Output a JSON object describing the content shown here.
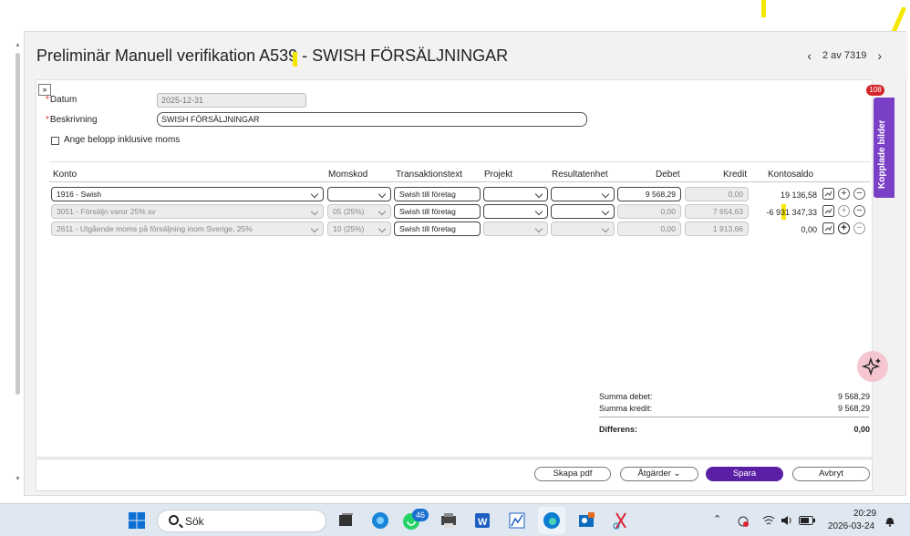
{
  "header": {
    "title": "Preliminär Manuell verifikation A539  - SWISH FÖRSÄLJNINGAR",
    "page_counter": "2 av 7319"
  },
  "form": {
    "datum_label": "Datum",
    "datum_value": "2025-12-31",
    "beskrivning_label": "Beskrivning",
    "beskrivning_value": "SWISH FÖRSÄLJNINGAR",
    "moms_checkbox_label": "Ange belopp inklusive moms"
  },
  "table": {
    "headers": {
      "konto": "Konto",
      "momskod": "Momskod",
      "transaktionstext": "Transaktionstext",
      "projekt": "Projekt",
      "resultatenhet": "Resultatenhet",
      "debet": "Debet",
      "kredit": "Kredit",
      "kontosaldo": "Kontosaldo"
    },
    "rows": [
      {
        "konto": "1916 - Swish",
        "momskod": "",
        "text": "Swish till företag",
        "projekt": "",
        "resultatenhet": "",
        "debet": "9 568,29",
        "kredit": "0,00",
        "saldo": "19 136,58"
      },
      {
        "konto": "3051 - Försäljn varor 25% sv",
        "momskod": "05 (25%)",
        "text": "Swish till företag",
        "projekt": "",
        "resultatenhet": "",
        "debet": "0,00",
        "kredit": "7 654,63",
        "saldo": "-6 931 347,33"
      },
      {
        "konto": "2611 - Utgående moms på försäljning inom Sverige, 25%",
        "momskod": "10 (25%)",
        "text": "Swish till företag",
        "projekt": "",
        "resultatenhet": "",
        "debet": "0,00",
        "kredit": "1 913,66",
        "saldo": "0,00"
      }
    ]
  },
  "summary": {
    "summa_debet_label": "Summa debet:",
    "summa_debet_value": "9 568,29",
    "summa_kredit_label": "Summa kredit:",
    "summa_kredit_value": "9 568,29",
    "differens_label": "Differens:",
    "differens_value": "0,00"
  },
  "footer": {
    "skapa_pdf": "Skapa pdf",
    "atgarder": "Åtgärder",
    "spara": "Spara",
    "avbryt": "Avbryt"
  },
  "side_tab": {
    "label": "Kopplade bilder",
    "badge": "108"
  },
  "taskbar": {
    "search_placeholder": "Sök",
    "whatsapp_badge": "46",
    "time": "20:29",
    "date": "2026-03-24"
  },
  "colors": {
    "primary": "#5b1fa6",
    "side_tab": "#7a3fc7",
    "badge": "#d4262a",
    "highlight": "#f4e800"
  }
}
